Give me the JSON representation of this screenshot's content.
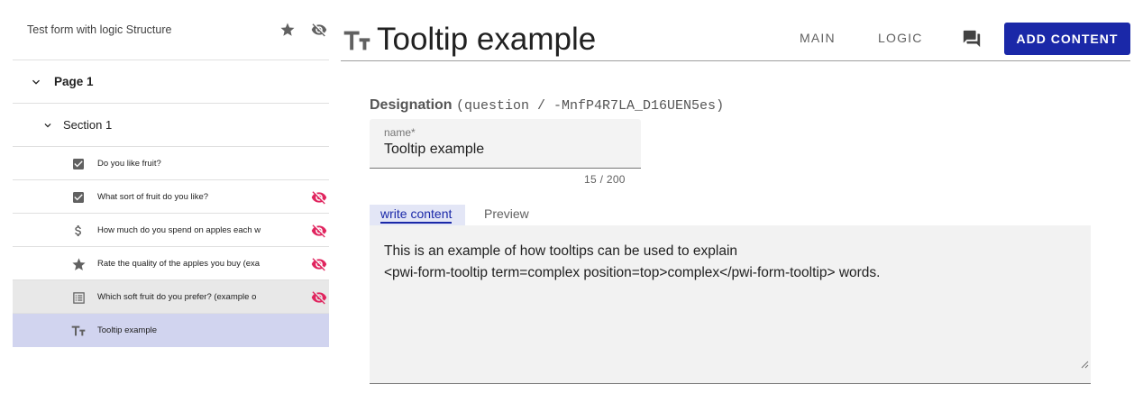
{
  "sidebar": {
    "form_title": "Test form with logic Structure",
    "page": {
      "label": "Page 1"
    },
    "section": {
      "label": "Section 1"
    },
    "items": [
      {
        "label": "Do you like fruit?",
        "icon": "checkbox-icon",
        "hidden": false
      },
      {
        "label": "What sort of fruit do you like?",
        "icon": "checkbox-icon",
        "hidden": true
      },
      {
        "label": "How much do you spend on apples each w",
        "icon": "dollar-icon",
        "hidden": true
      },
      {
        "label": "Rate the quality of the apples you buy (exa",
        "icon": "star-icon",
        "hidden": true
      },
      {
        "label": "Which soft fruit do you prefer? (example o",
        "icon": "list-icon",
        "hidden": true
      },
      {
        "label": "Tooltip example",
        "icon": "text-type-icon",
        "hidden": false,
        "selected": true
      }
    ]
  },
  "header": {
    "title": "Tooltip example",
    "nav": {
      "main": "MAIN",
      "logic": "LOGIC"
    },
    "add_button": "ADD CONTENT"
  },
  "main": {
    "designation_label": "Designation",
    "designation_id": "(question / -MnfP4R7LA_D16UEN5es)",
    "name_field": {
      "label": "name*",
      "value": "Tooltip example",
      "counter": "15 / 200"
    },
    "tabs": {
      "write": "write content",
      "preview": "Preview"
    },
    "content": "This is an example of how tooltips can be used to explain\n<pwi-form-tooltip term=complex position=top>complex</pwi-form-tooltip> words."
  },
  "colors": {
    "accent": "#1a28a8",
    "hidden_icon": "#e0245e",
    "selected_row": "#d1d4ef",
    "grey_row": "#e8e8e8"
  }
}
